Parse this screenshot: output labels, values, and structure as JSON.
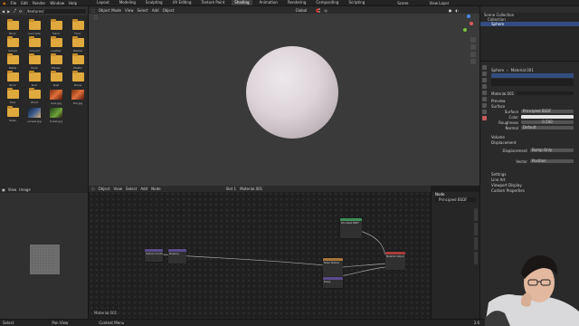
{
  "topbar": {
    "menus": [
      "File",
      "Edit",
      "Render",
      "Window",
      "Help"
    ],
    "workspaces": [
      "Layout",
      "Modeling",
      "Sculpting",
      "UV Editing",
      "Texture Paint",
      "Shading",
      "Animation",
      "Rendering",
      "Compositing",
      "Scripting"
    ],
    "active_workspace": "Shading",
    "scene": "Scene",
    "view_layer": "View Layer"
  },
  "file_browser": {
    "path": "/textures/",
    "items": [
      {
        "label": "Brick",
        "kind": "folder"
      },
      {
        "label": "Concrete",
        "kind": "folder"
      },
      {
        "label": "Fabric",
        "kind": "folder"
      },
      {
        "label": "Floor",
        "kind": "folder"
      },
      {
        "label": "Gravel",
        "kind": "folder"
      },
      {
        "label": "Ground",
        "kind": "folder"
      },
      {
        "label": "Leather",
        "kind": "folder"
      },
      {
        "label": "Marble",
        "kind": "folder"
      },
      {
        "label": "Metal",
        "kind": "folder"
      },
      {
        "label": "Paint",
        "kind": "folder"
      },
      {
        "label": "Plaster",
        "kind": "folder"
      },
      {
        "label": "Plastic",
        "kind": "folder"
      },
      {
        "label": "Rock",
        "kind": "folder"
      },
      {
        "label": "Roof",
        "kind": "folder"
      },
      {
        "label": "Rust",
        "kind": "folder"
      },
      {
        "label": "Stone",
        "kind": "folder"
      },
      {
        "label": "Tiles",
        "kind": "folder"
      },
      {
        "label": "Wood",
        "kind": "folder"
      },
      {
        "label": "lava.jpg",
        "kind": "thumb-orange"
      },
      {
        "label": "fire.jpg",
        "kind": "thumb-orange"
      },
      {
        "label": "Skies",
        "kind": "folder"
      },
      {
        "label": "sunset.jpg",
        "kind": "thumb-blue"
      },
      {
        "label": "forest.jpg",
        "kind": "thumb-green"
      },
      {
        "label": "",
        "kind": "empty"
      }
    ]
  },
  "image_editor": {
    "view_label": "View",
    "image_label": "Image"
  },
  "viewport": {
    "mode": "Object Mode",
    "menus": [
      "View",
      "Select",
      "Add",
      "Object"
    ],
    "transform": "Global"
  },
  "node_editor": {
    "object_label": "Object",
    "menus": [
      "View",
      "Select",
      "Add",
      "Node"
    ],
    "slot": "Slot 1",
    "material": "Material.001",
    "material_footer": "Material.001",
    "nodes": {
      "tex_coord": "Texture Coordinate",
      "mapping": "Mapping",
      "noise": "Noise Texture",
      "bump": "Bump",
      "bsdf": "Principled BSDF",
      "output": "Material Output"
    },
    "panel_title": "Node",
    "panel_name": "Principled BSDF"
  },
  "outliner": {
    "rows": [
      "Scene Collection",
      "Collection",
      "Sphere"
    ]
  },
  "properties": {
    "object": "Sphere",
    "material": "Material.001",
    "sections": {
      "preview": "Preview",
      "surface": "Surface",
      "volume": "Volume",
      "displacement": "Displacement",
      "settings": "Settings",
      "line_art": "Line Art",
      "viewport_display": "Viewport Display",
      "custom_properties": "Custom Properties"
    },
    "fields": {
      "surface_label": "Surface",
      "surface_value": "Principled BSDF",
      "color_label": "Color",
      "roughness_label": "Roughness",
      "roughness_value": "0.500",
      "normal_label": "Normal",
      "normal_value": "Default",
      "displacement_label": "Displacement",
      "displacement_value": "Bump Only",
      "vector_label": "Vector",
      "vector_value": "Position"
    }
  },
  "status_bar": {
    "items": [
      "Select",
      "Pan View",
      "Context Menu"
    ],
    "version": "3.6"
  },
  "colors": {
    "accent": "#334d80",
    "folder": "#e0a93e",
    "node_texture": "#a8743a",
    "node_vector": "#5a4a8c",
    "node_shader": "#3f8f5a",
    "node_output": "#a83a3a"
  }
}
